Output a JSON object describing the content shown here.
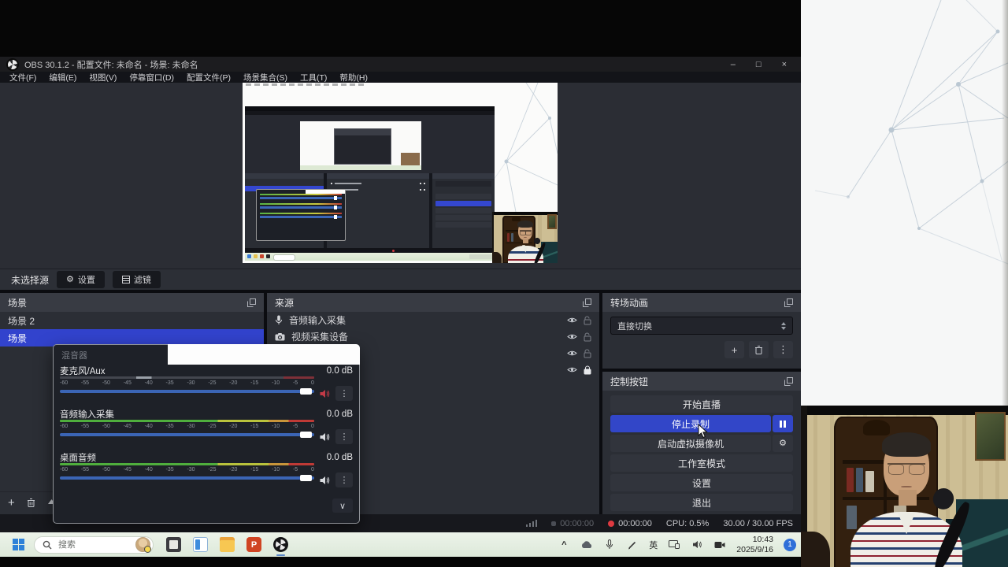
{
  "window": {
    "title": "OBS 30.1.2 - 配置文件: 未命名 - 场景: 未命名",
    "minimize": "–",
    "maximize": "□",
    "close": "×"
  },
  "menu": {
    "items": [
      "文件(F)",
      "编辑(E)",
      "视图(V)",
      "停靠窗口(D)",
      "配置文件(P)",
      "场景集合(S)",
      "工具(T)",
      "帮助(H)"
    ]
  },
  "toolbar": {
    "no_source": "未选择源",
    "settings": "设置",
    "filters": "滤镜"
  },
  "scenes": {
    "title": "场景",
    "items": [
      {
        "label": "场景 2"
      },
      {
        "label": "场景"
      }
    ]
  },
  "sources": {
    "title": "来源",
    "items": [
      {
        "label": "音频输入采集"
      },
      {
        "label": "视频采集设备"
      },
      {
        "label": ""
      },
      {
        "label": ""
      }
    ]
  },
  "transitions": {
    "title": "转场动画",
    "selected": "直接切换"
  },
  "controls": {
    "title": "控制按钮",
    "buttons": [
      "开始直播",
      "停止录制",
      "启动虚拟摄像机",
      "工作室模式",
      "设置",
      "退出"
    ]
  },
  "mixer": {
    "title": "混音器",
    "ticks": [
      "-60",
      "-55",
      "-50",
      "-45",
      "-40",
      "-35",
      "-30",
      "-25",
      "-20",
      "-15",
      "-10",
      "-5",
      "0"
    ],
    "channels": [
      {
        "name": "麦克风/Aux",
        "db": "0.0 dB"
      },
      {
        "name": "音频输入采集",
        "db": "0.0 dB"
      },
      {
        "name": "桌面音频",
        "db": "0.0 dB"
      }
    ],
    "expand": "∨"
  },
  "statusbar": {
    "stream_time": "00:00:00",
    "rec_time": "00:00:00",
    "cpu": "CPU: 0.5%",
    "fps": "30.00 / 30.00 FPS"
  },
  "taskbar": {
    "search_placeholder": "搜索",
    "ime": "英",
    "time": "10:43",
    "date": "2025/9/16",
    "badge": "1"
  },
  "colors": {
    "accent_blue": "#3246c8",
    "record_red": "#df3a41",
    "meter_green": "#4fae3d",
    "meter_red": "#bf3a36",
    "taskbar_tint": "#e3ede0"
  }
}
